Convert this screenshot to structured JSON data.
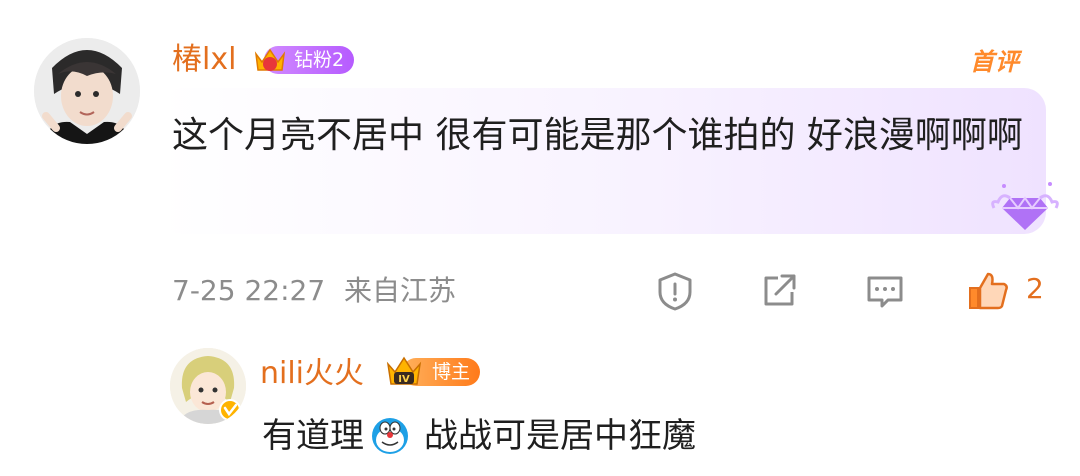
{
  "comment": {
    "username": "椿lxl",
    "badge_label": "钻粉2",
    "badge_level": "1",
    "first_comment_tag": "首评",
    "text": "这个月亮不居中 很有可能是那个谁拍的 好浪漫啊啊啊",
    "timestamp": "7-25 22:27",
    "location": "来自江苏",
    "like_count": "2"
  },
  "reply": {
    "username": "nili火火",
    "badge_label": "博主",
    "text_before_emoji": "有道理",
    "emoji": "doraemon-emoji",
    "text_after_emoji": "战战可是居中狂魔"
  },
  "colors": {
    "username": "#e36f1e",
    "accent_orange": "#ff8a2b",
    "meta": "#8c8c8c",
    "fan_badge": "#b65bff"
  },
  "icons": [
    "report-icon",
    "share-icon",
    "comment-icon",
    "like-icon"
  ]
}
